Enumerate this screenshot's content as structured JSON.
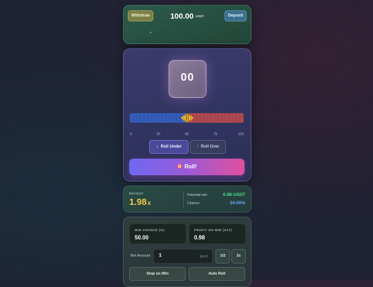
{
  "wallet": {
    "withdraw_label": "Withdraw",
    "deposit_label": "Deposit",
    "balance": "100.00",
    "currency": "USDT"
  },
  "game": {
    "dice_value": "00",
    "slider": {
      "min": 0,
      "max": 100,
      "value": 50,
      "ticks": [
        "0",
        "25",
        "50",
        "75",
        "100"
      ]
    },
    "roll_under_label": "Roll Under",
    "roll_over_label": "Roll Over",
    "active_mode": "roll-under",
    "roll_label": "Roll!",
    "colors": {
      "under": "#3f6fd0",
      "over": "#c85a60",
      "roll_start": "#6d68f2",
      "roll_end": "#e0509c"
    }
  },
  "payout": {
    "label": "PAYOUT",
    "multiplier": "1.98",
    "multiplier_suffix": "x",
    "potential_win_label": "Potential win:",
    "potential_win_value": "0.98 USDT",
    "chance_label": "Chance:",
    "chance_value": "50.00%"
  },
  "controls": {
    "win_chance_label": "WIN CHANCE (%)",
    "win_chance_value": "50.00",
    "profit_label": "PROFIT ON WIN (SAT)",
    "profit_value": "0.98",
    "bet_amount_label": "Bet Amount",
    "bet_amount_value": "1",
    "bet_unit": "(SAT)",
    "half_label": "1/2",
    "double_label": "2x",
    "stop_on_win_label": "Stop on Win",
    "auto_roll_label": "Auto Roll"
  }
}
